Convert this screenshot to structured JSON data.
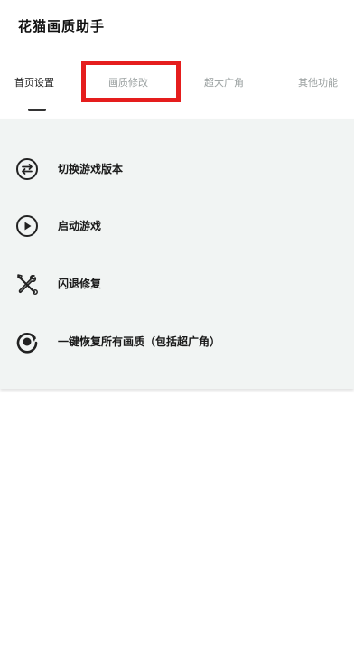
{
  "app": {
    "title": "花猫画质助手"
  },
  "tabs": [
    {
      "label": "首页设置",
      "active": true
    },
    {
      "label": "画质修改",
      "active": false
    },
    {
      "label": "超大广角",
      "active": false
    },
    {
      "label": "其他功能",
      "active": false
    }
  ],
  "menu": [
    {
      "label": "切换游戏版本",
      "icon": "swap-icon"
    },
    {
      "label": "启动游戏",
      "icon": "play-icon"
    },
    {
      "label": "闪退修复",
      "icon": "tools-icon"
    },
    {
      "label": "一键恢复所有画质（包括超广角）",
      "icon": "restore-icon"
    }
  ],
  "colors": {
    "highlight": "#e51d1d",
    "panel": "#f1f4f3"
  }
}
